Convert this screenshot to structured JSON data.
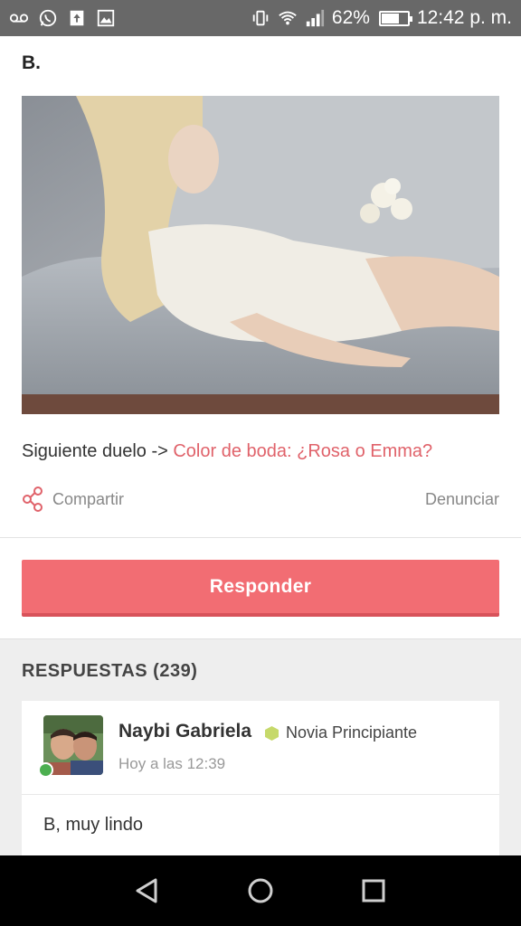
{
  "status_bar": {
    "battery_percent": "62%",
    "battery_level": 0.62,
    "time": "12:42 p. m.",
    "left_icons": [
      "voicemail-icon",
      "whatsapp-icon",
      "upload-icon",
      "gallery-icon"
    ],
    "right_icons": [
      "vibrate-icon",
      "wifi-icon",
      "signal-icon",
      "battery-icon"
    ]
  },
  "post": {
    "letter": "B.",
    "next_duel_prefix": "Siguiente duelo -> ",
    "next_duel_link": "Color de boda: ¿Rosa o Emma?",
    "share_label": "Compartir",
    "report_label": "Denunciar",
    "reply_button": "Responder"
  },
  "replies": {
    "title": "RESPUESTAS (239)",
    "items": [
      {
        "user": "Naybi Gabriela",
        "badge": "Novia Principiante",
        "time": "Hoy a las 12:39",
        "text": "B, muy lindo",
        "online": true
      }
    ]
  },
  "colors": {
    "accent": "#f26d73",
    "link": "#e0626a",
    "status_bar": "#686868",
    "badge": "#c6d96a",
    "online": "#4caf50"
  },
  "nav_bar": {
    "buttons": [
      "back-icon",
      "home-icon",
      "recents-icon"
    ]
  }
}
